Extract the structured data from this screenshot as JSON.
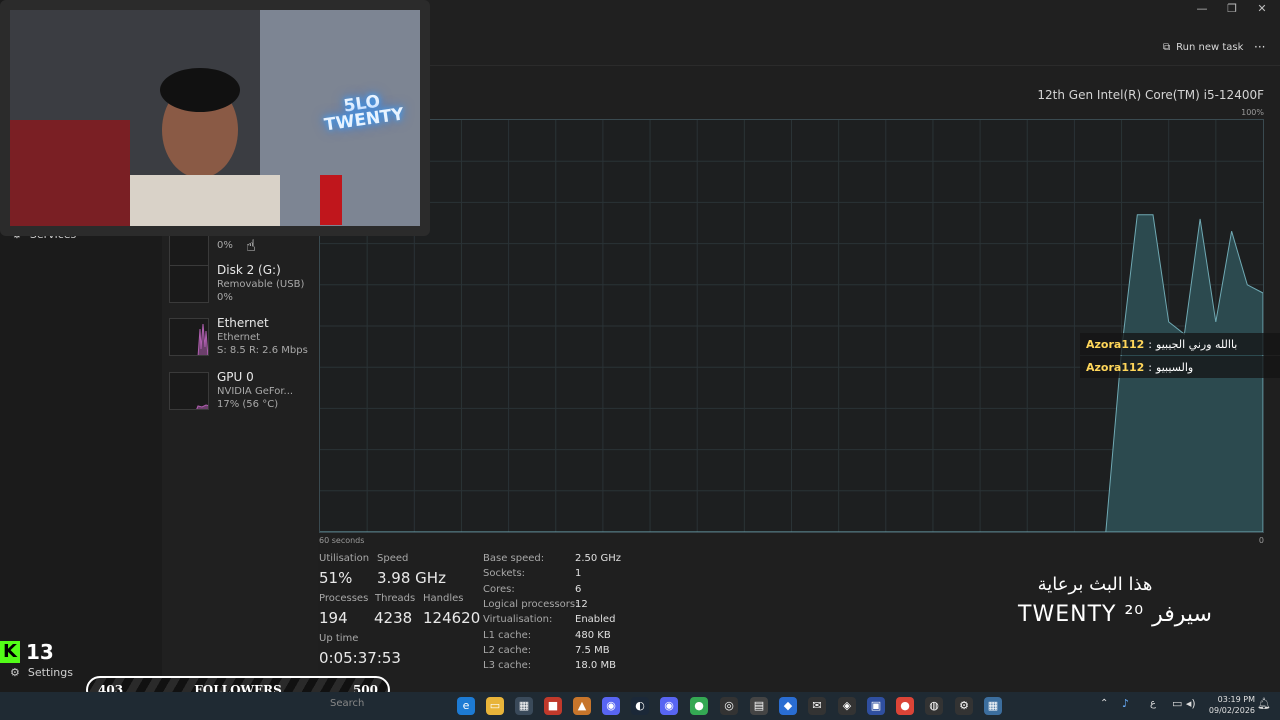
{
  "nav": {
    "services_label": "Services",
    "settings_label": "Settings"
  },
  "devices": [
    {
      "name": "",
      "type": "",
      "value": "0%"
    },
    {
      "name": "Disk 2 (G:)",
      "type": "Removable (USB)",
      "value": "0%"
    },
    {
      "name": "Ethernet",
      "type": "Ethernet",
      "value": "S: 8.5 R: 2.6 Mbps"
    },
    {
      "name": "GPU 0",
      "type": "NVIDIA GeFor...",
      "value": "17% (56 °C)"
    }
  ],
  "toolbar": {
    "run_new_task": "Run new task",
    "more": "···"
  },
  "window": {
    "minimize": "—",
    "restore": "❐",
    "close": "✕"
  },
  "cpu": {
    "name": "12th Gen Intel(R) Core(TM) i5-12400F",
    "max_label": "100%",
    "time_label": "60 seconds",
    "min_label": "0",
    "stats": {
      "utilisation_label": "Utilisation",
      "utilisation": "51%",
      "speed_label": "Speed",
      "speed": "3.98 GHz",
      "processes_label": "Processes",
      "processes": "194",
      "threads_label": "Threads",
      "threads": "4238",
      "handles_label": "Handles",
      "handles": "124620",
      "uptime_label": "Up time",
      "uptime": "0:05:37:53"
    },
    "specs": [
      {
        "label": "Base speed:",
        "value": "2.50 GHz"
      },
      {
        "label": "Sockets:",
        "value": "1"
      },
      {
        "label": "Cores:",
        "value": "6"
      },
      {
        "label": "Logical processors:",
        "value": "12"
      },
      {
        "label": "Virtualisation:",
        "value": "Enabled"
      },
      {
        "label": "L1 cache:",
        "value": "480 KB"
      },
      {
        "label": "L2 cache:",
        "value": "7.5 MB"
      },
      {
        "label": "L3 cache:",
        "value": "18.0 MB"
      }
    ]
  },
  "chart_data": {
    "type": "area",
    "xlabel": "60 seconds",
    "ylim": [
      0,
      100
    ],
    "x": [
      0,
      1,
      2,
      3,
      4,
      5,
      6,
      7,
      8,
      9,
      10,
      11,
      12,
      13,
      14,
      15,
      16,
      17,
      18,
      19,
      20,
      21,
      22,
      23,
      24,
      25,
      26,
      27,
      28,
      29,
      30,
      31,
      32,
      33,
      34,
      35,
      36,
      37,
      38,
      39,
      40,
      41,
      42,
      43,
      44,
      45,
      46,
      47,
      48,
      49,
      50,
      51,
      52,
      53,
      54,
      55,
      56,
      57,
      58,
      59,
      60
    ],
    "values": [
      0,
      0,
      0,
      0,
      0,
      0,
      0,
      0,
      0,
      0,
      0,
      0,
      0,
      0,
      0,
      0,
      0,
      0,
      0,
      0,
      0,
      0,
      0,
      0,
      0,
      0,
      0,
      0,
      0,
      0,
      0,
      0,
      0,
      0,
      0,
      0,
      0,
      0,
      0,
      0,
      0,
      0,
      0,
      0,
      0,
      0,
      0,
      0,
      0,
      0,
      0,
      44,
      77,
      77,
      51,
      48,
      76,
      51,
      73,
      60,
      58
    ]
  },
  "chat": [
    {
      "user": "Azora112",
      "message": "باالله ورني الجيبيو"
    },
    {
      "user": "Azora112",
      "message": "والسيبيو"
    }
  ],
  "sponsor": {
    "line1": "هذا البث برعاية",
    "line2": "TWENTY ²⁰ سيرفر"
  },
  "kick": {
    "count": "13"
  },
  "goal": {
    "current": "403",
    "label": "FOLLOWERS",
    "target": "500"
  },
  "webcam": {
    "neon_text": "5LO TWENTY"
  },
  "taskbar": {
    "search_placeholder": "Search",
    "time": "03:19 PM",
    "date": "09/02/2026",
    "lang": "ع"
  },
  "colors": {
    "graph_fill": "#2c4a4f",
    "graph_line": "#6fa9b3",
    "accent": "#53fc18"
  }
}
